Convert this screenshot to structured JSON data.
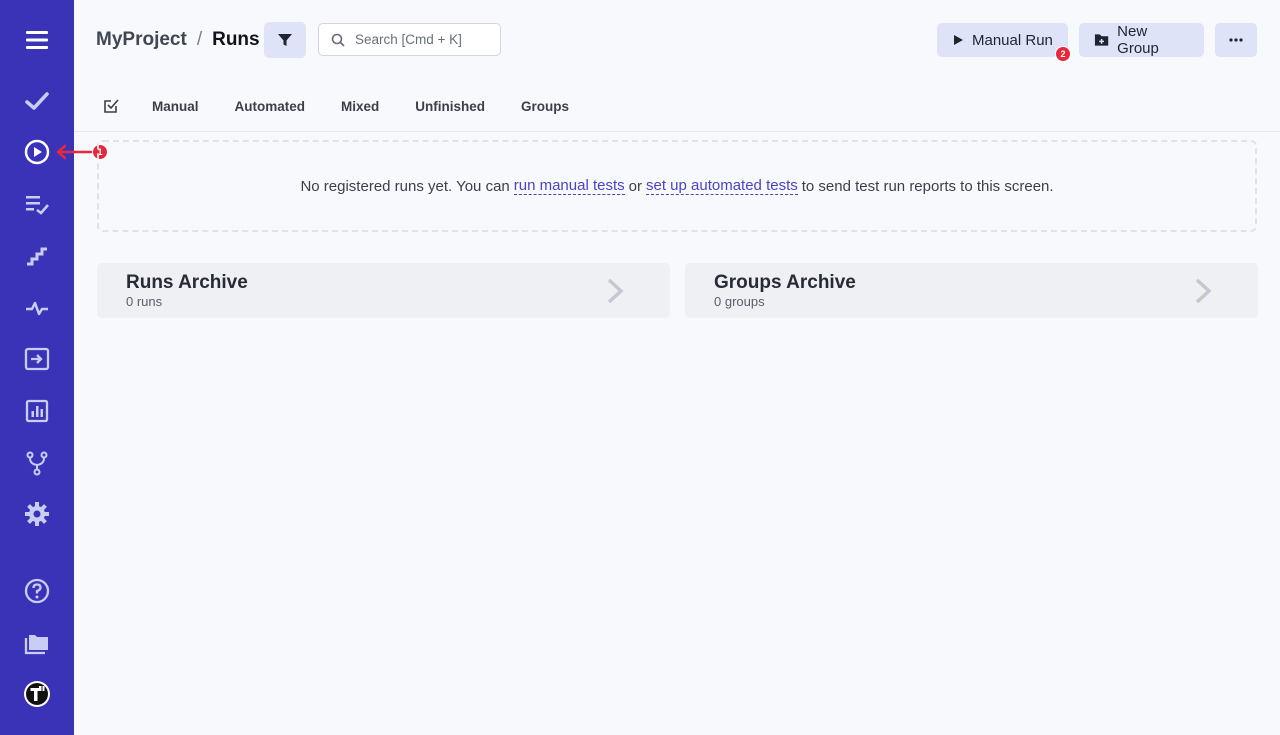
{
  "breadcrumb": {
    "project": "MyProject",
    "separator": "/",
    "current": "Runs"
  },
  "search": {
    "placeholder": "Search [Cmd + K]"
  },
  "toolbar": {
    "manual_run_label": "Manual Run",
    "manual_run_badge": "2",
    "new_group_label": "New Group"
  },
  "sidebar": {
    "items": [
      {
        "icon": "menu-icon"
      },
      {
        "icon": "check-icon"
      },
      {
        "icon": "play-circle-icon",
        "badge": "1"
      },
      {
        "icon": "checklist-icon"
      },
      {
        "icon": "steps-icon"
      },
      {
        "icon": "pulse-icon"
      },
      {
        "icon": "import-icon"
      },
      {
        "icon": "bar-chart-icon"
      },
      {
        "icon": "branch-icon"
      },
      {
        "icon": "gear-icon"
      },
      {
        "icon": "help-icon"
      },
      {
        "icon": "folders-icon"
      },
      {
        "icon": "logo-icon"
      }
    ]
  },
  "tabs": [
    "Manual",
    "Automated",
    "Mixed",
    "Unfinished",
    "Groups"
  ],
  "empty_state": {
    "text_before": "No registered runs yet. You can",
    "link1": "run manual tests",
    "text_middle": "or",
    "link2": "set up automated tests",
    "text_after": "to send test run reports to this screen."
  },
  "archives": {
    "runs": {
      "title": "Runs Archive",
      "count": "0 runs"
    },
    "groups": {
      "title": "Groups Archive",
      "count": "0 groups"
    }
  },
  "colors": {
    "sidebar_bg": "#3a33b8",
    "accent": "#4a44c4",
    "button_bg": "#dfe3f7",
    "badge": "#e5283a"
  }
}
